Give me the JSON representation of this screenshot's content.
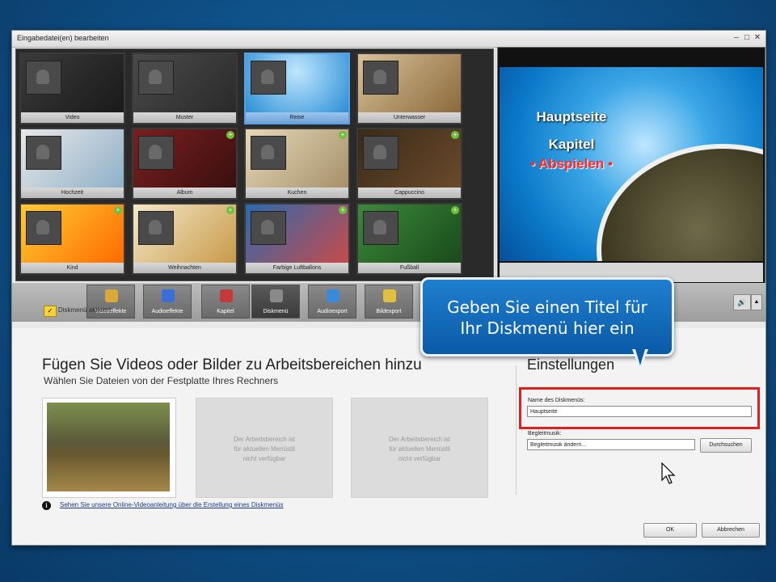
{
  "window": {
    "title": "Eingabedatei(en) bearbeiten"
  },
  "templates": [
    {
      "name": "Video",
      "badge": false,
      "selected": false
    },
    {
      "name": "Muster",
      "badge": false,
      "selected": false
    },
    {
      "name": "Reise",
      "badge": false,
      "selected": true
    },
    {
      "name": "Unterwasser",
      "badge": false,
      "selected": false
    },
    {
      "name": "Hochzeit",
      "badge": false,
      "selected": false
    },
    {
      "name": "Album",
      "badge": true,
      "selected": false
    },
    {
      "name": "Kuchen",
      "badge": true,
      "selected": false
    },
    {
      "name": "Cappuccino",
      "badge": true,
      "selected": false
    },
    {
      "name": "Kind",
      "badge": true,
      "selected": false
    },
    {
      "name": "Weihnachten",
      "badge": true,
      "selected": false
    },
    {
      "name": "Farbige Luftballons",
      "badge": true,
      "selected": false
    },
    {
      "name": "Fußball",
      "badge": true,
      "selected": false
    }
  ],
  "preview": {
    "line1": "Hauptseite",
    "line2": "Kapitel",
    "line3": "• Abspielen •"
  },
  "toolbar": [
    {
      "label": "Videoeffekte",
      "color": "#d9a93a"
    },
    {
      "label": "Audioeffekte",
      "color": "#3a6fd9"
    },
    {
      "label": "Kapitel",
      "color": "#c23a3a"
    },
    {
      "label": "Diskmenü",
      "color": "#8a8a8a",
      "active": true
    },
    {
      "label": "Audioexport",
      "color": "#3a8ad9"
    },
    {
      "label": "Bildexport",
      "color": "#e0c040"
    }
  ],
  "callout": {
    "line1": "Geben Sie einen Titel für",
    "line2": "Ihr Diskmenü hier ein"
  },
  "diskmenu": {
    "checkbox_label": "Diskmenü aktiviert",
    "heading": "Fügen Sie Videos oder Bilder zu Arbeitsbereichen hinzu",
    "subheading": "Wählen Sie Dateien von der Festplatte Ihres Rechners",
    "slot_text": [
      "Der Arbeitsbereich ist",
      "für aktuellen Menüstil",
      "nicht verfügbar"
    ],
    "help_link": "Sehen Sie unsere Online-Videoanleitung über die Erstellung eines Diskmenüs"
  },
  "settings": {
    "title": "Einstellungen",
    "name_label": "Name des Diskmenüs:",
    "name_value": "Hauptseite",
    "music_label": "Begleitmusik:",
    "music_value": "Begleitmusik ändern...",
    "browse_label": "Durchsuchen"
  },
  "dialog_buttons": {
    "ok": "OK",
    "cancel": "Abbrechen"
  }
}
